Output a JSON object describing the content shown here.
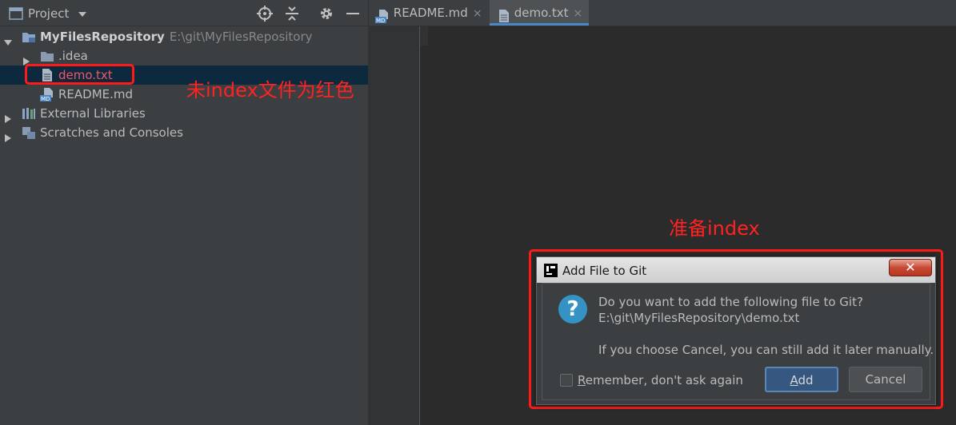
{
  "project_panel": {
    "title": "Project",
    "tree": [
      {
        "label": "MyFilesRepository",
        "path_hint": "E:\\git\\MyFilesRepository"
      },
      {
        "label": ".idea"
      },
      {
        "label": "demo.txt"
      },
      {
        "label": "README.md"
      },
      {
        "label": "External Libraries"
      },
      {
        "label": "Scratches and Consoles"
      }
    ]
  },
  "annotations": {
    "untracked_note": "未index文件为红色",
    "prepare_note": "准备index"
  },
  "editor": {
    "tabs": [
      {
        "label": "README.md",
        "icon": "markdown-file-icon"
      },
      {
        "label": "demo.txt",
        "icon": "text-file-icon"
      }
    ],
    "tab_close_glyph": "×"
  },
  "dialog": {
    "title": "Add File to Git",
    "close_glyph": "✕",
    "question_glyph": "?",
    "message_line1": "Do you want to add the following file to Git?",
    "message_line2": "E:\\git\\MyFilesRepository\\demo.txt",
    "message_line3": "If you choose Cancel, you can still add it later manually.",
    "remember_label_first": "R",
    "remember_label_rest": "emember, don't ask again",
    "add_label_first": "A",
    "add_label_rest": "dd",
    "cancel_label": "Cancel"
  },
  "colors": {
    "untracked_file": "#f75464",
    "annotation_red": "#ff1a1a",
    "accent_blue": "#4a88c7"
  }
}
